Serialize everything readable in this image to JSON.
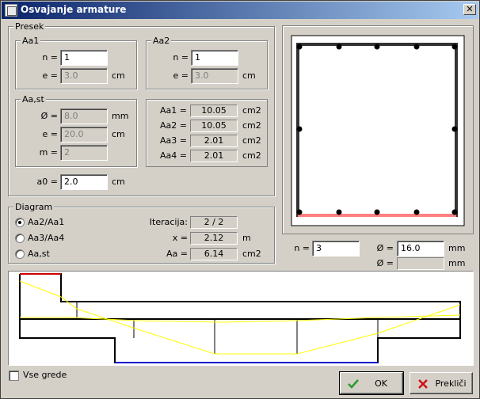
{
  "window": {
    "title": "Osvajanje armature",
    "close_glyph": "✕"
  },
  "presek": {
    "legend": "Presek",
    "aa1": {
      "legend": "Aa1",
      "n_label": "n =",
      "n_value": "1",
      "e_label": "e =",
      "e_value": "3.0",
      "e_unit": "cm"
    },
    "aa2": {
      "legend": "Aa2",
      "n_label": "n =",
      "n_value": "1",
      "e_label": "e =",
      "e_value": "3.0",
      "e_unit": "cm"
    },
    "aast": {
      "legend": "Aa,st",
      "d_label": "Ø =",
      "d_value": "8.0",
      "d_unit": "mm",
      "e_label": "e =",
      "e_value": "20.0",
      "e_unit": "cm",
      "m_label": "m =",
      "m_value": "2"
    },
    "areas": [
      {
        "label": "Aa1 =",
        "value": "10.05",
        "unit": "cm2"
      },
      {
        "label": "Aa2 =",
        "value": "10.05",
        "unit": "cm2"
      },
      {
        "label": "Aa3 =",
        "value": "2.01",
        "unit": "cm2"
      },
      {
        "label": "Aa4 =",
        "value": "2.01",
        "unit": "cm2"
      }
    ],
    "a0_label": "a0 =",
    "a0_value": "2.0",
    "a0_unit": "cm"
  },
  "diagram": {
    "legend": "Diagram",
    "options": [
      {
        "label": "Aa2/Aa1",
        "selected": true
      },
      {
        "label": "Aa3/Aa4",
        "selected": false
      },
      {
        "label": "Aa,st",
        "selected": false
      }
    ],
    "iter_label": "Iteracija:",
    "iter_value": "2 / 2",
    "x_label": "x =",
    "x_value": "2.12",
    "x_unit": "m",
    "aa_label": "Aa =",
    "aa_value": "6.14",
    "aa_unit": "cm2"
  },
  "section_view": {
    "n_label": "n =",
    "n_value": "3",
    "d1_label": "Ø =",
    "d1_value": "16.0",
    "d1_unit": "mm",
    "d2_label": "Ø =",
    "d2_value": "",
    "d2_unit": "mm"
  },
  "footer": {
    "vse_grede_label": "Vse grede",
    "vse_grede_checked": false,
    "ok_label": "OK",
    "cancel_label": "Prekliči"
  },
  "colors": {
    "title_start": "#0a246a",
    "title_end": "#a6caf0",
    "bar_highlight": "#ff8080",
    "diagram_line": "#ffff00",
    "support_red": "#cc0000",
    "support_blue": "#0000cc",
    "ok_green": "#2a9a2a",
    "cancel_red": "#d01010"
  },
  "icons": {
    "window_icon": "window-icon",
    "ok_icon": "check-icon",
    "cancel_icon": "cross-icon"
  }
}
